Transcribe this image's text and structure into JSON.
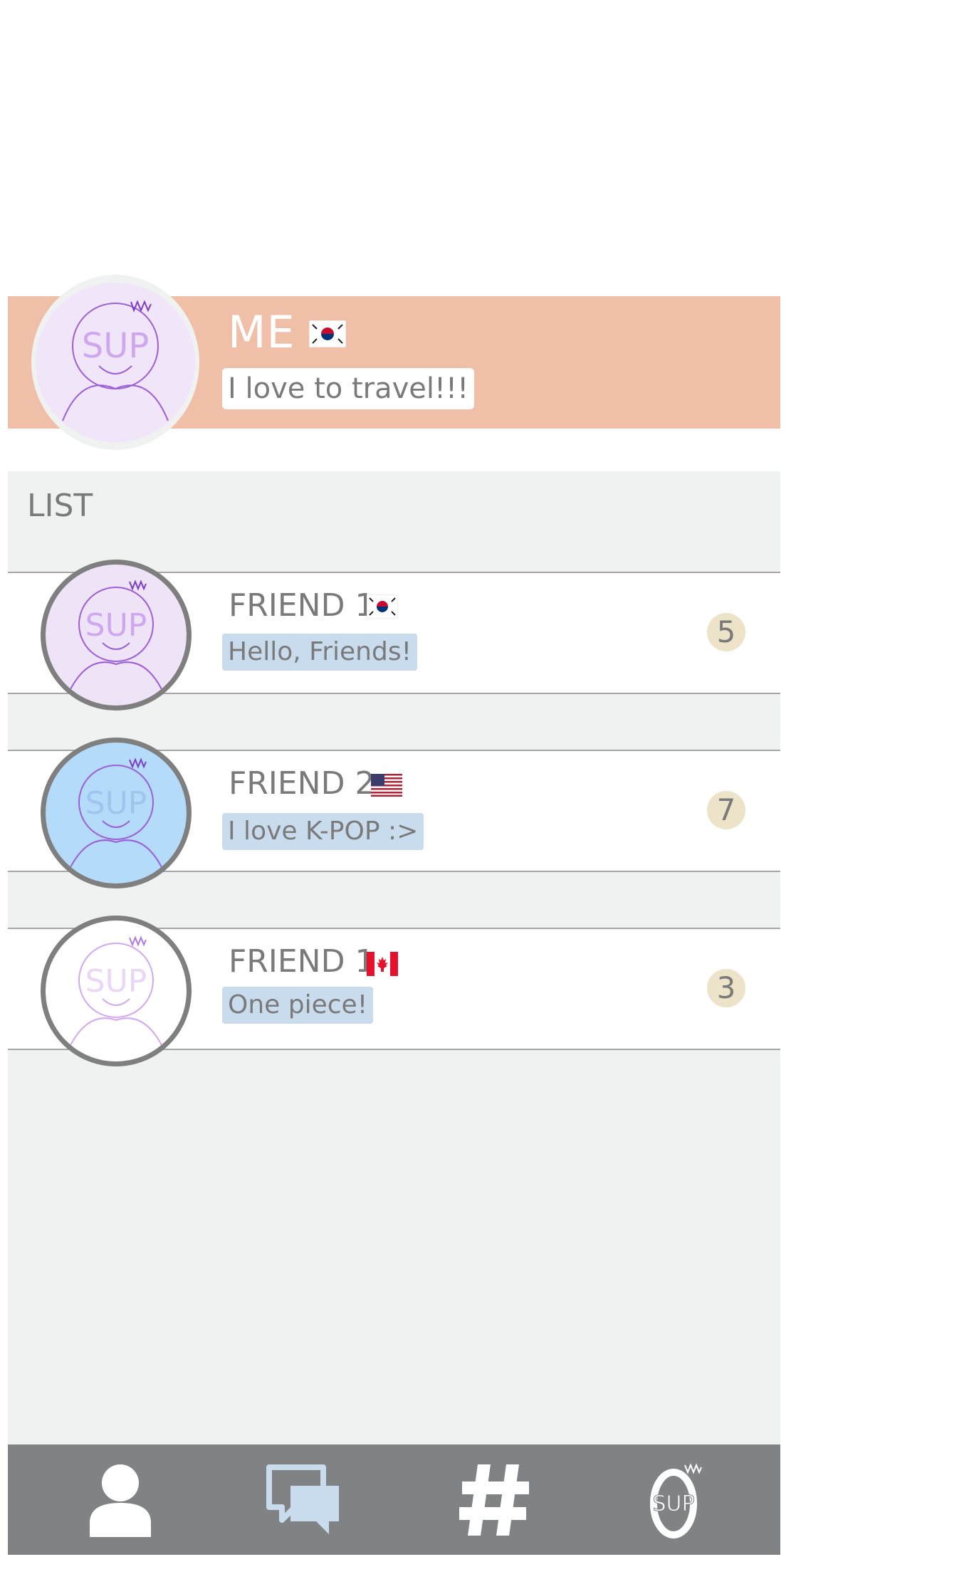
{
  "profile": {
    "name": "ME",
    "status": "I love to travel!!!",
    "flag": "kr-flag-icon",
    "avatar": {
      "text": "SUP",
      "icon": "sup-avatar-icon"
    }
  },
  "list": {
    "title": "LIST",
    "friends": [
      {
        "name": "FRIEND 1",
        "status": "Hello, Friends!",
        "count": "5",
        "flag": "kr-flag-icon",
        "avatar_color": "#efe3f8",
        "avatar_text": "SUP"
      },
      {
        "name": "FRIEND 2",
        "status": "I love K-POP :>",
        "count": "7",
        "flag": "us-flag-icon",
        "avatar_color": "#b5dbfa",
        "avatar_text": "SUP"
      },
      {
        "name": "FRIEND 1",
        "status": "One piece!",
        "count": "3",
        "flag": "ca-flag-icon",
        "avatar_color": "#ffffff",
        "avatar_text": "SUP"
      }
    ]
  },
  "nav": {
    "items": [
      {
        "name": "friends",
        "icon": "person-icon"
      },
      {
        "name": "chats",
        "icon": "chat-bubbles-icon"
      },
      {
        "name": "hashtag",
        "icon": "hashtag-icon"
      },
      {
        "name": "sup",
        "icon": "sup-logo-icon",
        "text": "SUP"
      }
    ]
  },
  "colors": {
    "header_bar": "#efc0a7",
    "list_background": "#eff2f0",
    "status_bubble": "#c9dcee",
    "badge": "#ece3c8",
    "nav_background": "#818284",
    "avatar_line": "#b07be0"
  }
}
